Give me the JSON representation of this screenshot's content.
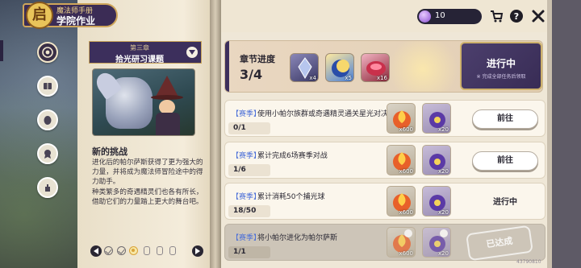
{
  "app": {
    "banner_sub": "魔法师手册",
    "banner_title": "学院作业",
    "logo_glyph": "启"
  },
  "topbar": {
    "currency_value": "10",
    "icons": [
      "shop-cart-icon",
      "help-icon",
      "close-icon"
    ]
  },
  "sidebar": {
    "items": [
      {
        "name": "sidebar-item-coursework",
        "icon": "target-icon",
        "active": true
      },
      {
        "name": "sidebar-item-book",
        "icon": "book-icon",
        "active": false
      },
      {
        "name": "sidebar-item-egg",
        "icon": "egg-icon",
        "active": false
      },
      {
        "name": "sidebar-item-badge",
        "icon": "badge-icon",
        "active": false
      },
      {
        "name": "sidebar-item-hand",
        "icon": "hand-icon",
        "active": false
      }
    ]
  },
  "chapter": {
    "label": "第三章",
    "title": "拾光研习课题"
  },
  "story": {
    "heading": "新的挑战",
    "paragraph1": "进化后的帕尔萨斯获得了更为强大的力量，并将成为魔法师冒险途中的得力助手。",
    "paragraph2": "种类繁多的奇遇精灵们也各有所长，借助它们的力量踏上更大的舞台吧。"
  },
  "pagination": {
    "dots": [
      "done",
      "done",
      "current",
      "locked",
      "locked",
      "locked"
    ]
  },
  "progress": {
    "label": "章节进度",
    "count": "3/4",
    "rewards": [
      {
        "icon": "crystal-icon",
        "qty": "x4"
      },
      {
        "icon": "moon-orb-icon",
        "qty": "x5"
      },
      {
        "icon": "red-gem-icon",
        "qty": "x16"
      }
    ],
    "status": "进行中",
    "status_sub": "※ 完成全部任务后领取"
  },
  "tasks": [
    {
      "tag": "【赛季】",
      "desc": "使用小帕尔族群或奇遇精灵通关星光对决",
      "progress": "0/1",
      "rewards": [
        {
          "icon": "fire-orb-icon",
          "qty": "x600"
        },
        {
          "icon": "purple-orb-icon",
          "qty": "x20"
        }
      ],
      "action": "前往",
      "state": "go"
    },
    {
      "tag": "【赛季】",
      "desc": "累计完成6场赛季对战",
      "progress": "1/6",
      "rewards": [
        {
          "icon": "fire-orb-icon",
          "qty": "x600"
        },
        {
          "icon": "purple-orb-icon",
          "qty": "x20"
        }
      ],
      "action": "前往",
      "state": "go"
    },
    {
      "tag": "【赛季】",
      "desc": "累计消耗50个捕光球",
      "progress": "18/50",
      "rewards": [
        {
          "icon": "fire-orb-icon",
          "qty": "x600"
        },
        {
          "icon": "purple-orb-icon",
          "qty": "x20"
        }
      ],
      "action": "进行中",
      "state": "ongoing"
    },
    {
      "tag": "【赛季】",
      "desc": "将小帕尔进化为帕尔萨斯",
      "progress": "1/1",
      "rewards": [
        {
          "icon": "fire-orb-icon",
          "qty": "x600"
        },
        {
          "icon": "purple-orb-icon",
          "qty": "x20"
        }
      ],
      "action": "已达成",
      "state": "done"
    }
  ],
  "uid_text": "43790810",
  "colors": {
    "brand_purple": "#3c2f5c",
    "gold": "#cfa65a",
    "tag_blue": "#4b6fd8",
    "paper": "#efe6d3"
  }
}
